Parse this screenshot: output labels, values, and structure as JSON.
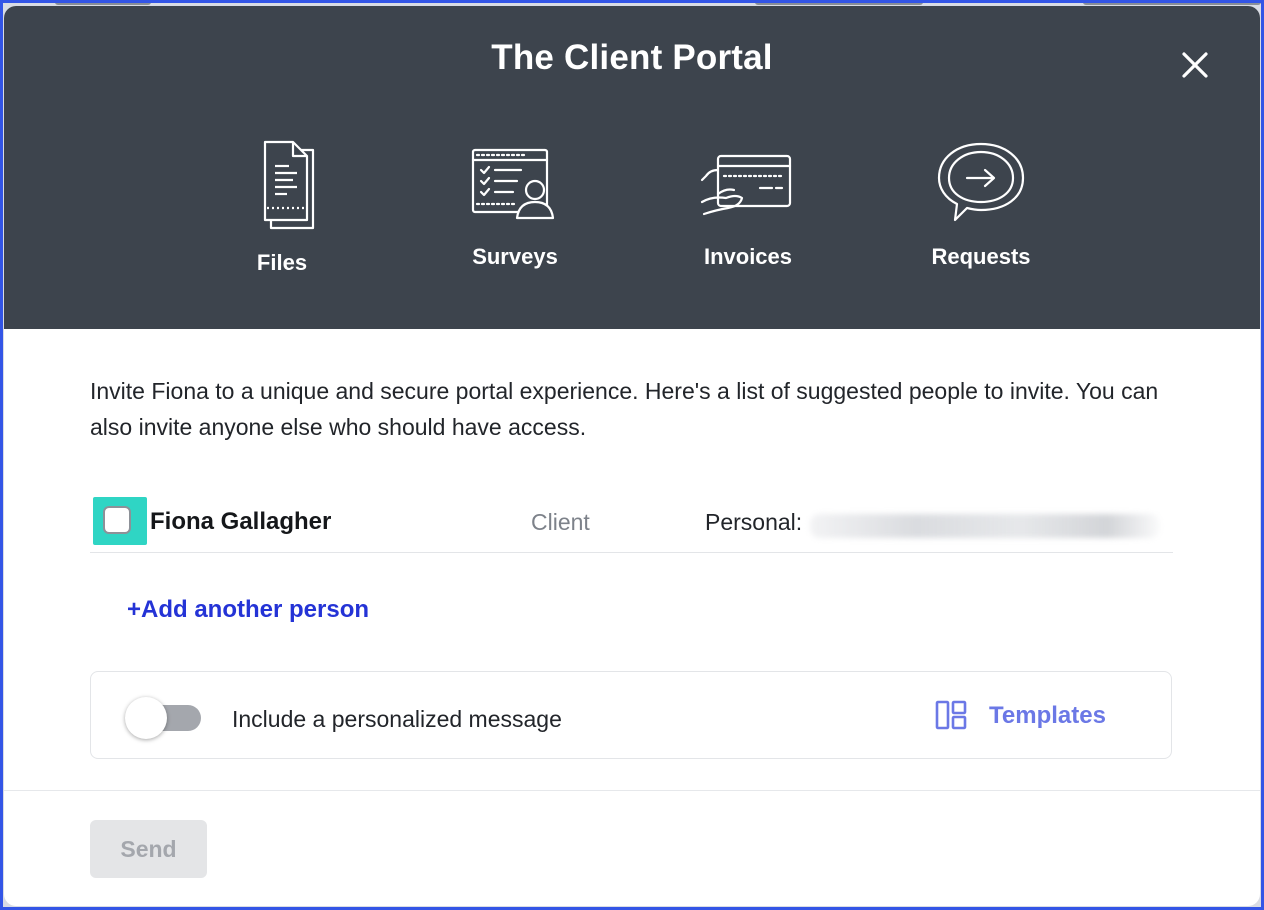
{
  "modal": {
    "title": "The Client Portal"
  },
  "features": [
    {
      "label": "Files",
      "icon": "files-icon"
    },
    {
      "label": "Surveys",
      "icon": "surveys-icon"
    },
    {
      "label": "Invoices",
      "icon": "invoices-icon"
    },
    {
      "label": "Requests",
      "icon": "requests-icon"
    }
  ],
  "intro_text": "Invite Fiona to a unique and secure portal experience. Here's a list of suggested people to invite. You can also invite anyone else who should have access.",
  "people": [
    {
      "name": "Fiona Gallagher",
      "role": "Client",
      "email_label": "Personal:",
      "checked": false
    }
  ],
  "add_person_label": "+Add another person",
  "message": {
    "label": "Include a personalized message",
    "enabled": false,
    "templates_label": "Templates"
  },
  "footer": {
    "send_label": "Send",
    "send_disabled": true
  },
  "colors": {
    "header_bg": "#3d444d",
    "link_blue": "#2433d6",
    "templates_purple": "#6b78e6",
    "focus_teal": "#2fd5c4",
    "frame_blue": "#3355e6"
  }
}
